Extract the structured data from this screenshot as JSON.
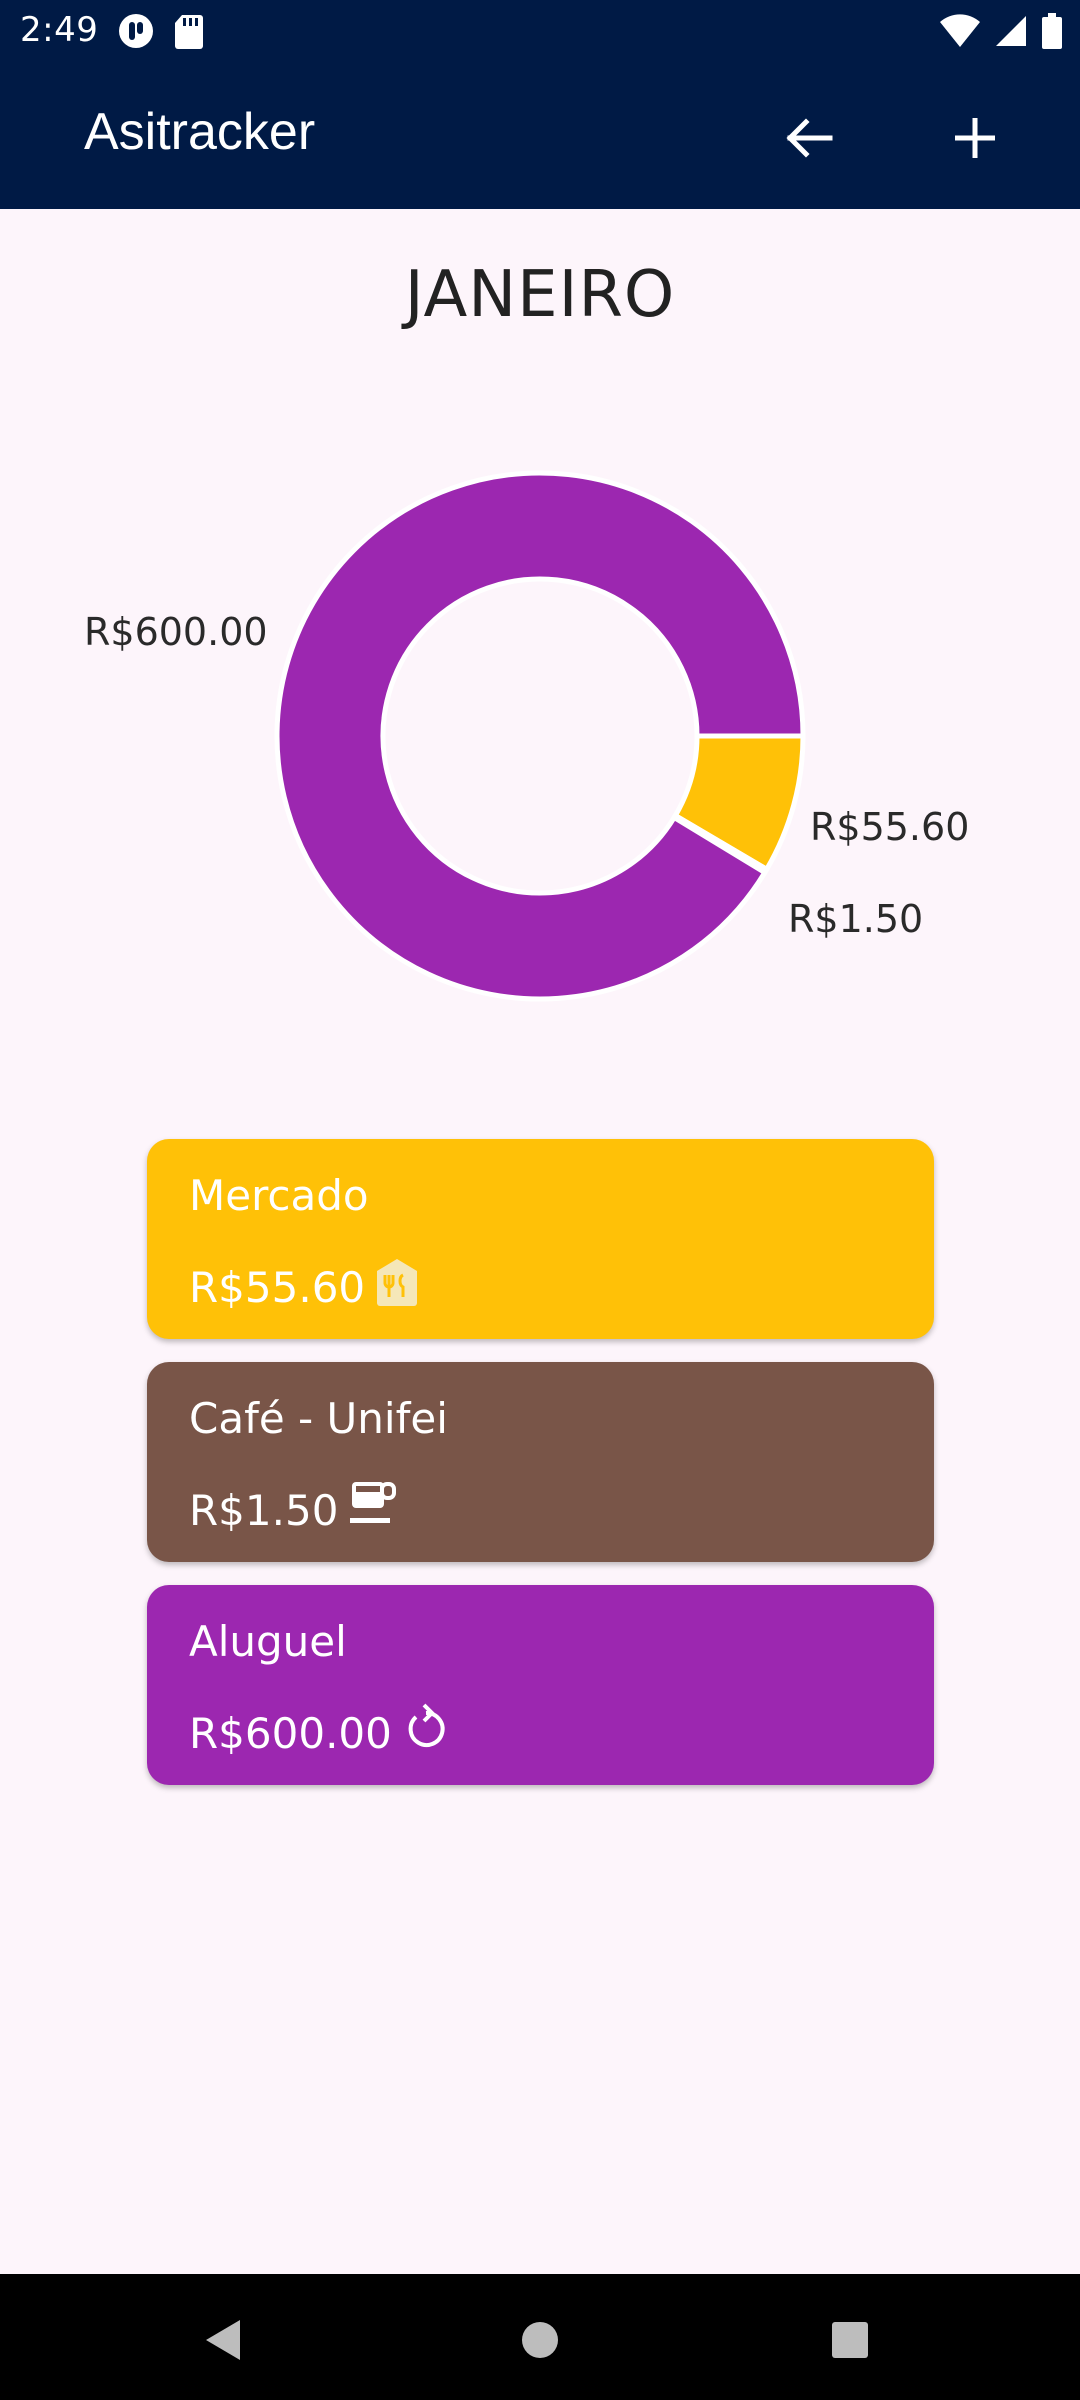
{
  "status_bar": {
    "time": "2:49",
    "icons": [
      "app-notification-icon",
      "sd-card-icon",
      "wifi-icon",
      "signal-icon",
      "battery-icon"
    ]
  },
  "app_bar": {
    "title": "Asitracker",
    "actions": [
      {
        "name": "back",
        "icon": "arrow-left-icon"
      },
      {
        "name": "add",
        "icon": "plus-icon"
      }
    ]
  },
  "month": "JANEIRO",
  "chart_data": {
    "type": "pie",
    "categories": [
      "Mercado",
      "Café - Unifei",
      "Aluguel"
    ],
    "values": [
      55.6,
      1.5,
      600.0
    ],
    "labels": [
      "R$55.60",
      "R$1.50",
      "R$600.00"
    ],
    "colors": [
      "#ffc107",
      "#795548",
      "#9c27b0"
    ],
    "donut": true
  },
  "expenses": [
    {
      "title": "Mercado",
      "amount": "R$55.60",
      "icon": "restaurant-icon",
      "color": "#ffc107"
    },
    {
      "title": "Café - Unifei",
      "amount": "R$1.50",
      "icon": "coffee-icon",
      "color": "#795548"
    },
    {
      "title": "Aluguel",
      "amount": "R$600.00",
      "icon": "recurring-icon",
      "color": "#9c27b0"
    }
  ],
  "nav_bar": {
    "buttons": [
      "back-triangle-icon",
      "home-circle-icon",
      "recents-square-icon"
    ]
  }
}
